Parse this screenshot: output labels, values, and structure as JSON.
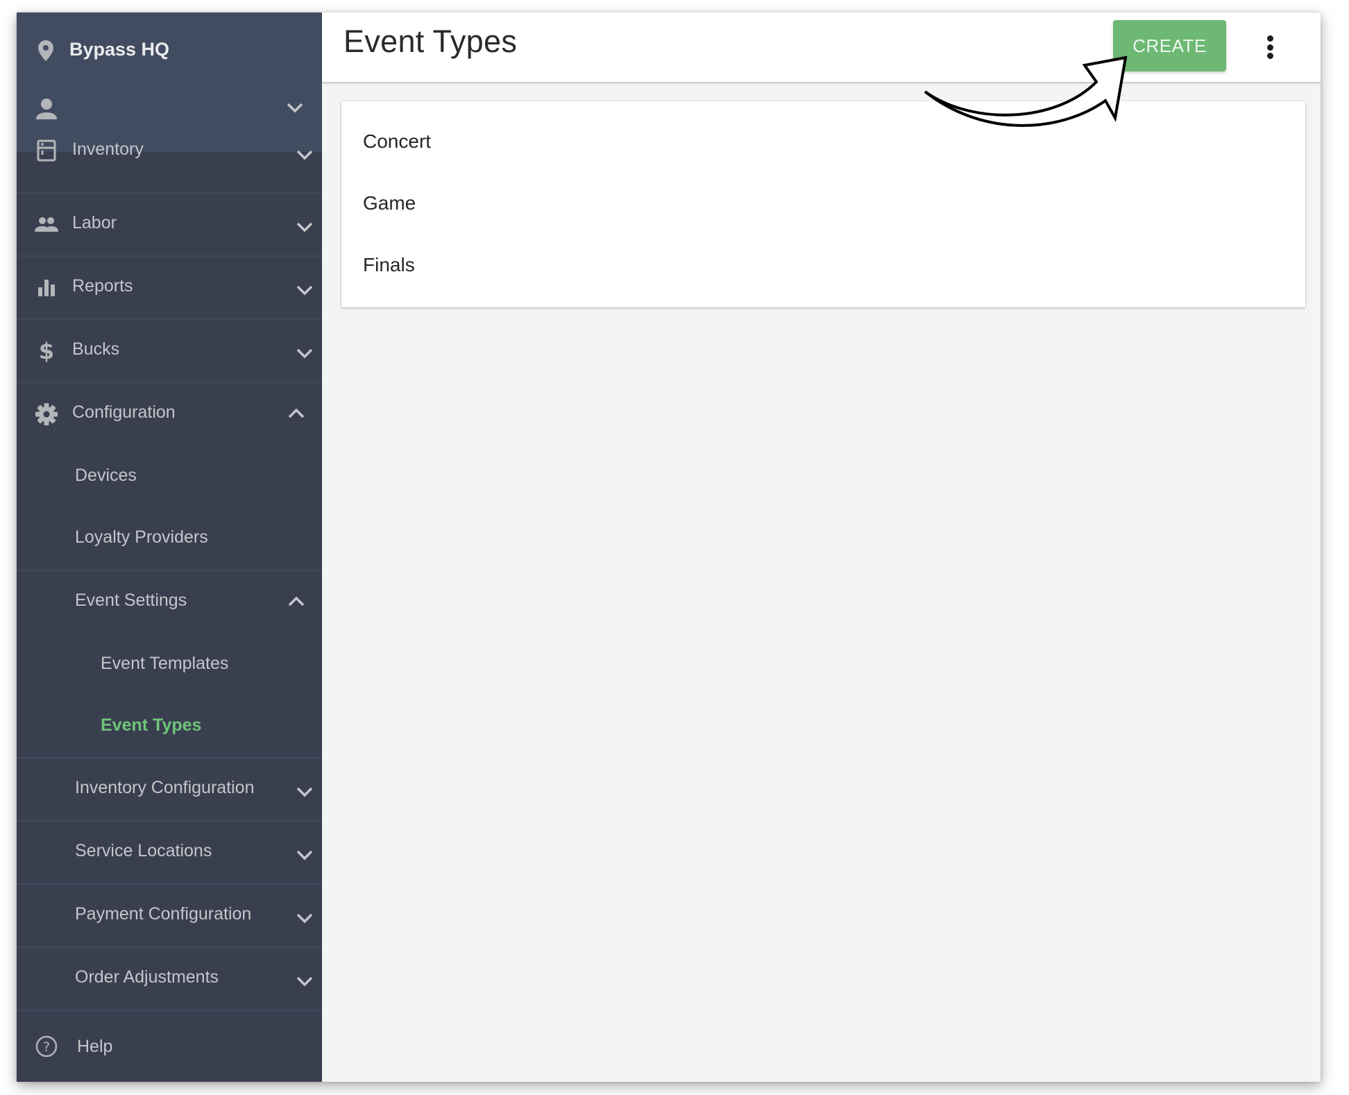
{
  "sidebar": {
    "venue": "Bypass HQ",
    "user_label": "",
    "items": [
      {
        "label": "Inventory",
        "icon": "inventory-icon",
        "state": "collapsed"
      },
      {
        "label": "Labor",
        "icon": "people-icon",
        "state": "collapsed"
      },
      {
        "label": "Reports",
        "icon": "bar-chart-icon",
        "state": "collapsed"
      },
      {
        "label": "Bucks",
        "icon": "dollar-icon",
        "state": "collapsed"
      },
      {
        "label": "Configuration",
        "icon": "gear-icon",
        "state": "expanded"
      }
    ],
    "configuration_children": [
      {
        "label": "Devices"
      },
      {
        "label": "Loyalty Providers"
      },
      {
        "label": "Event Settings",
        "state": "expanded"
      },
      {
        "label": "Inventory Configuration",
        "state": "collapsed"
      },
      {
        "label": "Service Locations",
        "state": "collapsed"
      },
      {
        "label": "Payment Configuration",
        "state": "collapsed"
      },
      {
        "label": "Order Adjustments",
        "state": "collapsed"
      }
    ],
    "event_settings_children": [
      {
        "label": "Event Templates",
        "active": false
      },
      {
        "label": "Event Types",
        "active": true
      }
    ],
    "help": "Help"
  },
  "header": {
    "title": "Event Types",
    "create_label": "CREATE",
    "more_icon": "kebab-menu-icon"
  },
  "event_types": [
    {
      "name": "Concert"
    },
    {
      "name": "Game"
    },
    {
      "name": "Finals"
    }
  ],
  "colors": {
    "accent_green": "#6db873",
    "active_nav": "#6fc37a",
    "sidebar_bg": "#393f4f",
    "sidebar_header_bg": "#424c60",
    "content_bg": "#f3f4f6"
  },
  "annotation": {
    "type": "arrow",
    "points_to": "create-button"
  }
}
